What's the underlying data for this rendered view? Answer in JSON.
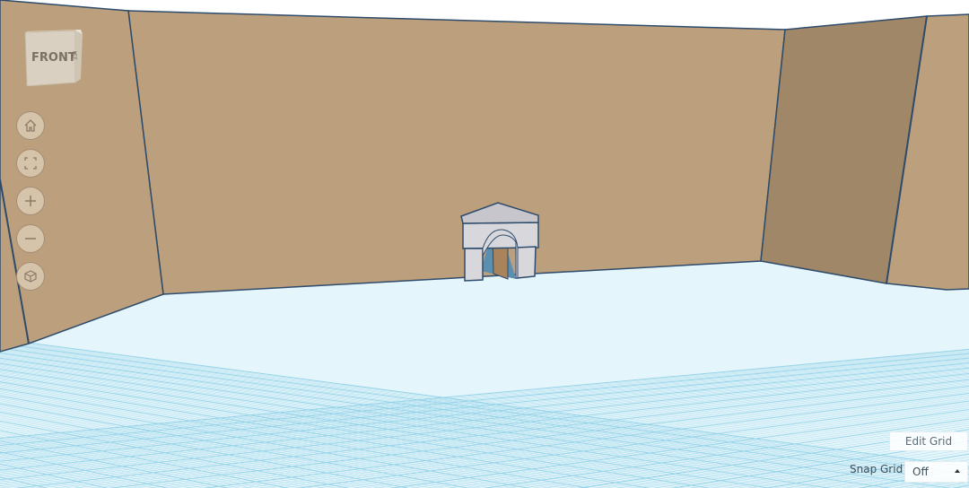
{
  "viewcube": {
    "front_label": "FRONT",
    "side_label": "LEFT"
  },
  "nav_buttons": [
    {
      "name": "home-view",
      "icon": "home-icon"
    },
    {
      "name": "fit-all",
      "icon": "fit-view-icon"
    },
    {
      "name": "zoom-in",
      "icon": "plus-icon"
    },
    {
      "name": "zoom-out",
      "icon": "minus-icon"
    },
    {
      "name": "perspective",
      "icon": "cube-icon"
    }
  ],
  "grid_controls": {
    "edit_grid_label": "Edit Grid",
    "snap_grid_label": "Snap Grid",
    "snap_grid_value": "Off"
  },
  "colors": {
    "wall": "#bc9f7d",
    "wall_side": "#9f8767",
    "floor": "#e4f5fb",
    "grid_line": "#8fd0e6",
    "edge": "#2e4b6b"
  }
}
